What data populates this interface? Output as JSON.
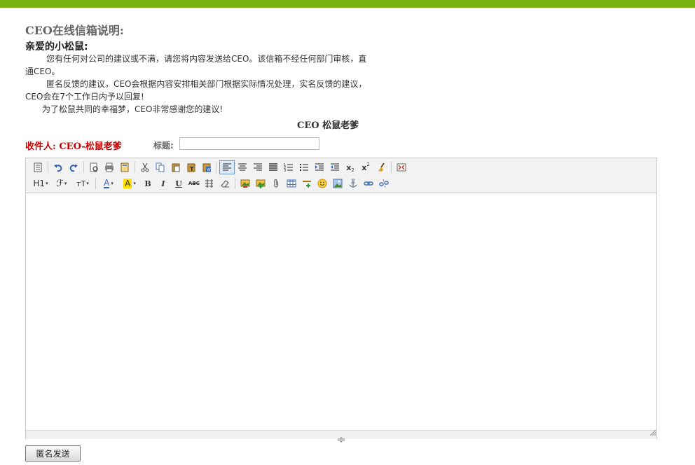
{
  "page": {
    "title": "CEO在线信箱说明:",
    "greeting": "亲爱的小松鼠:",
    "paragraphs": [
      "您有任何对公司的建议或不满，请您将内容发送给CEO。该信箱不经任何部门审核，直通CEO。",
      "匿名反馈的建议，CEO会根据内容安排相关部门根据实际情况处理，实名反馈的建议，CEO会在7个工作日内予以回复!",
      "为了松鼠共同的幸福梦，CEO非常感谢您的建议!"
    ],
    "signature": "CEO 松鼠老爹"
  },
  "form": {
    "recipient": "收件人: CEO-松鼠老爹",
    "subject_label": "标题:",
    "subject_value": "",
    "send_label": "匿名发送"
  },
  "editor": {
    "toolbar_row1": [
      "source-icon",
      "undo-icon",
      "redo-icon",
      "preview-icon",
      "print-icon",
      "template-icon",
      "cut-icon",
      "copy-icon",
      "paste-icon",
      "paste-text-icon",
      "paste-word-icon",
      "align-left-icon",
      "align-center-icon",
      "align-right-icon",
      "justify-icon",
      "ordered-list-icon",
      "unordered-list-icon",
      "indent-icon",
      "outdent-icon",
      "subscript-icon",
      "superscript-icon",
      "clear-format-icon",
      "fullscreen-icon"
    ],
    "toolbar_row2": [
      "heading-icon",
      "font-family-icon",
      "font-size-icon",
      "font-color-icon",
      "highlight-icon",
      "bold-icon",
      "italic-icon",
      "underline-icon",
      "strikethrough-icon",
      "line-height-icon",
      "remove-format-icon",
      "image-icon",
      "multi-image-icon",
      "attachment-icon",
      "table-icon",
      "hr-icon",
      "emoticon-icon",
      "picture-icon",
      "anchor-icon",
      "link-icon",
      "unlink-icon"
    ],
    "labels": {
      "heading": "H1",
      "font_family": "ℱ",
      "font_size": "тT",
      "font_color": "A",
      "highlight": "A",
      "bold": "B",
      "italic": "I",
      "underline": "U",
      "strikethrough": "ABC",
      "subscript": "x",
      "superscript": "x"
    },
    "colors": {
      "font_color": "#3a63c4",
      "highlight_bg": "#ffe100",
      "accent": "#77b20e",
      "recipient": "#cc0000"
    }
  }
}
